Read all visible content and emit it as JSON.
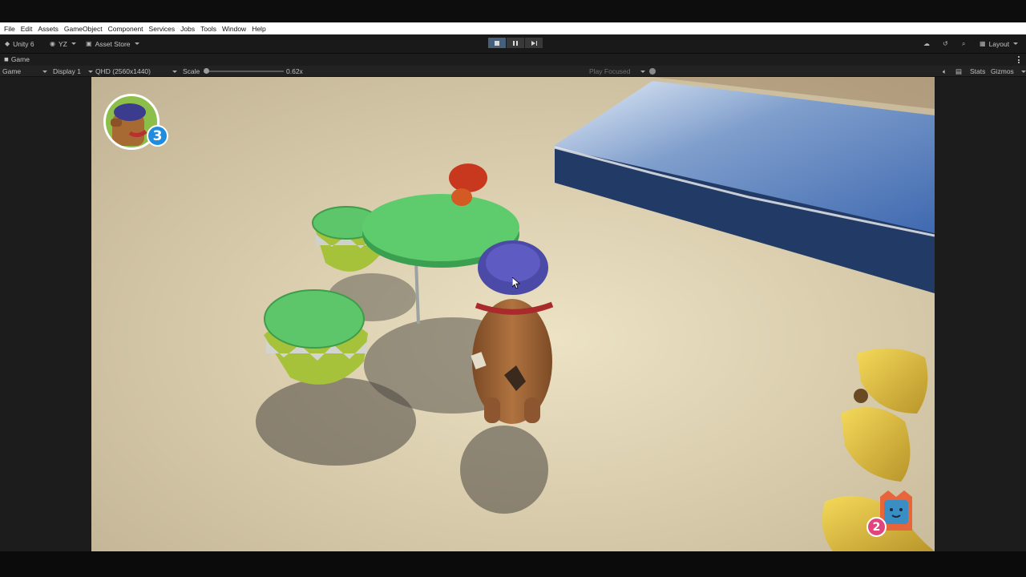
{
  "menu": {
    "items": [
      "File",
      "Edit",
      "Assets",
      "GameObject",
      "Component",
      "Services",
      "Jobs",
      "Tools",
      "Window",
      "Help"
    ]
  },
  "toolbar": {
    "app_label": "Unity 6",
    "account_label": "YZ",
    "asset_store_label": "Asset Store",
    "layout_label": "Layout",
    "icons": {
      "unity": "unity-logo-icon",
      "account": "account-icon",
      "store": "shopping-bag-icon",
      "play": "stop-square-icon",
      "pause": "pause-icon",
      "step": "step-forward-icon",
      "cloud": "cloud-icon",
      "history": "history-icon",
      "search": "search-icon",
      "layout": "layout-grid-icon"
    }
  },
  "game_tab": {
    "label": "Game",
    "icon": "gamepad-icon"
  },
  "game_bar": {
    "view_select": "Game",
    "display_select": "Display 1",
    "resolution_select": "QHD (2560x1440)",
    "scale_label": "Scale",
    "scale_value": "0.62x",
    "scale_fraction": 0.0,
    "play_mode": "Play Focused",
    "stats_label": "Stats",
    "gizmos_label": "Gizmos"
  },
  "hud": {
    "player_level": "3",
    "companion_count": "2"
  },
  "colors": {
    "play_active": "#46607c",
    "hud_badge_blue": "#1e8de0",
    "hud_badge_pink": "#e0457e",
    "floor": "#cdbf9f",
    "table_green": "#5ec66a",
    "water": "#4b74b3"
  }
}
